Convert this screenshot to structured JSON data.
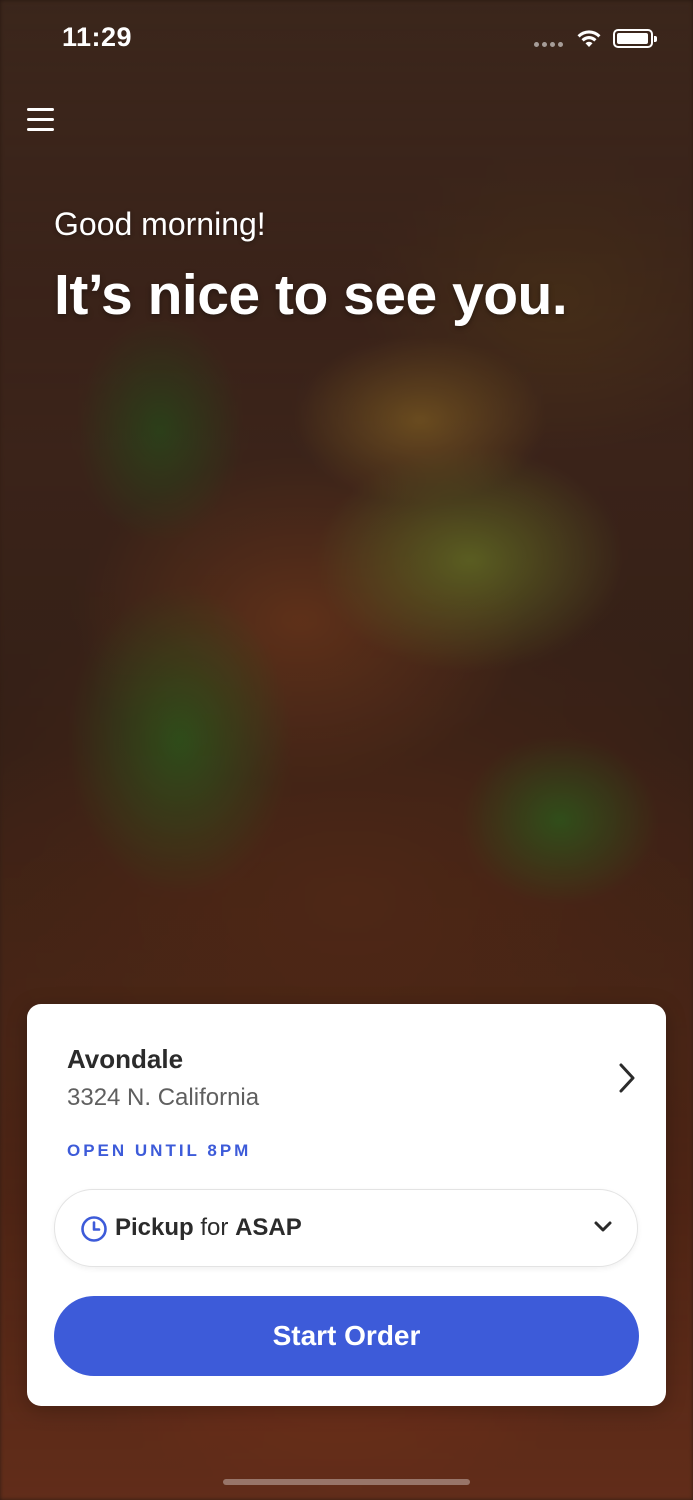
{
  "status_bar": {
    "time": "11:29",
    "icons": [
      "signal-dots-icon",
      "wifi-icon",
      "battery-icon"
    ]
  },
  "header": {
    "menu_icon": "hamburger-menu-icon"
  },
  "hero": {
    "greeting": "Good morning!",
    "headline": "It’s nice to see you."
  },
  "location_card": {
    "name": "Avondale",
    "address": "3324 N. California",
    "hours": "OPEN UNTIL 8PM",
    "order_type": "Pickup",
    "order_connector": "for",
    "order_time": "ASAP",
    "start_button_label": "Start Order"
  },
  "colors": {
    "accent": "#3d5bd9",
    "card_background": "#ffffff",
    "text_primary": "#2b2b2b",
    "text_secondary": "#5f5f5f"
  }
}
